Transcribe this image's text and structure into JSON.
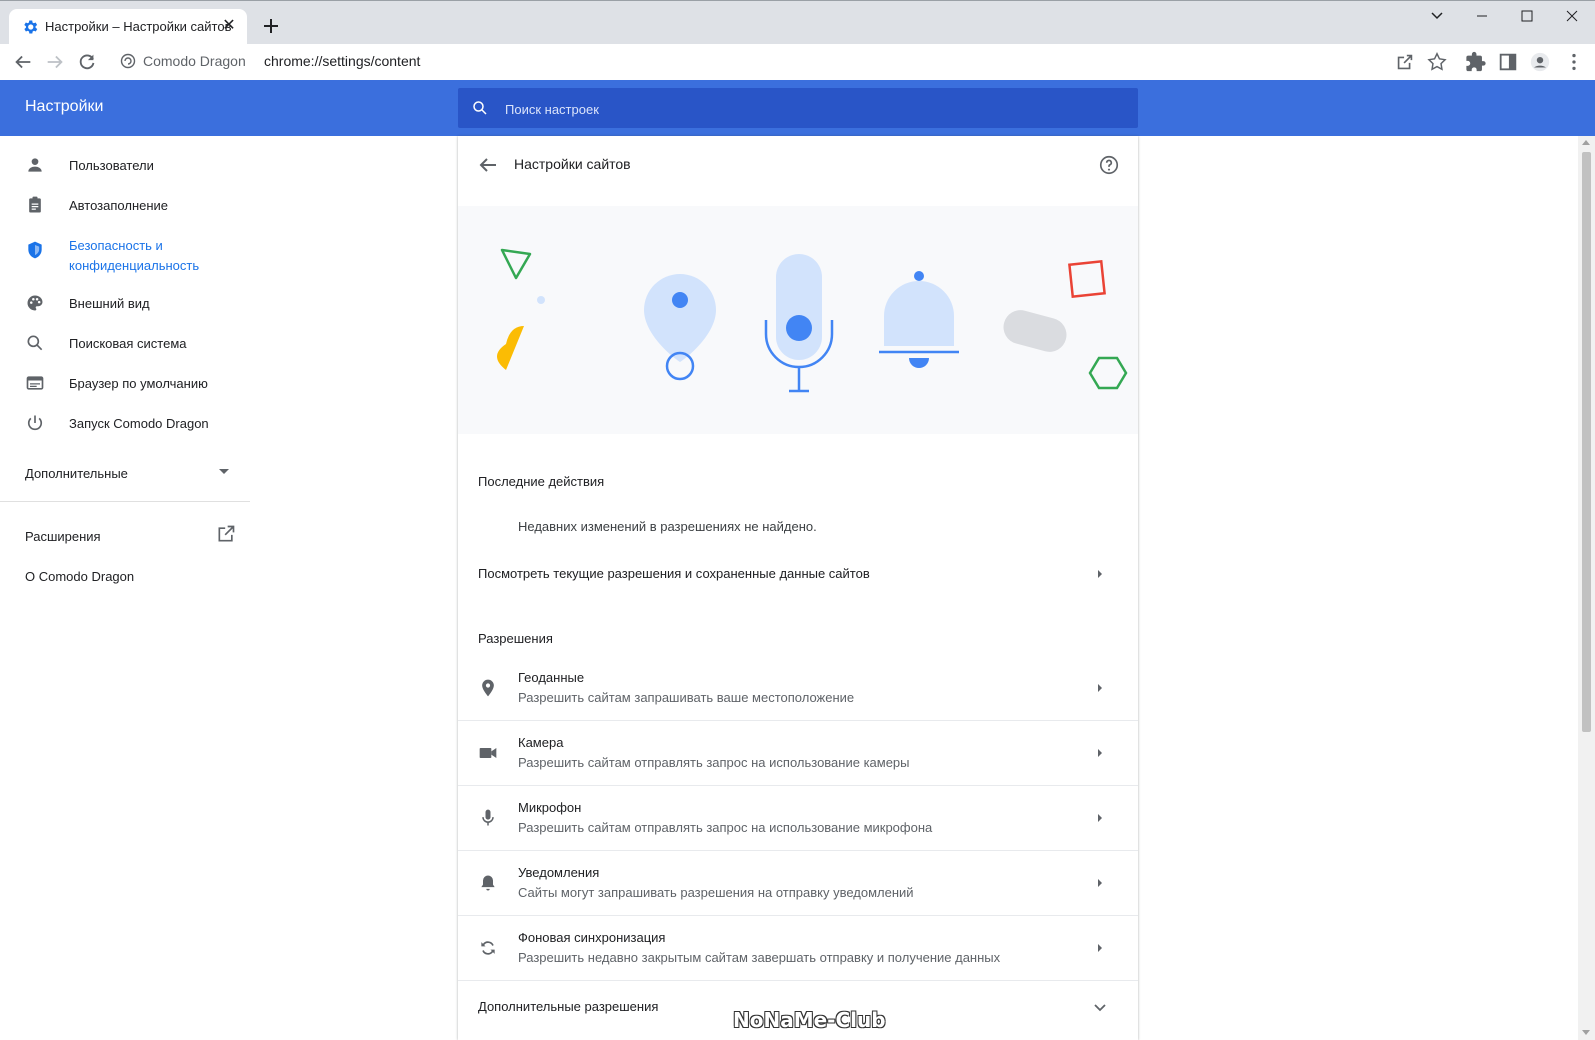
{
  "browser": {
    "tab_title": "Настройки – Настройки сайтов",
    "tab_favicon": "gear-icon",
    "brand": "Comodo Dragon",
    "url": "chrome://settings/content"
  },
  "header": {
    "title": "Настройки",
    "search_placeholder": "Поиск настроек",
    "color": "#3b6fdd"
  },
  "sidebar": {
    "items": [
      {
        "label": "Пользователи",
        "icon": "person-icon"
      },
      {
        "label": "Автозаполнение",
        "icon": "clipboard-icon"
      },
      {
        "label": "Безопасность и",
        "label2": "конфиденциальность",
        "icon": "shield-icon",
        "active": true
      },
      {
        "label": "Внешний вид",
        "icon": "palette-icon"
      },
      {
        "label": "Поисковая система",
        "icon": "search-icon"
      },
      {
        "label": "Браузер по умолчанию",
        "icon": "browser-window-icon"
      },
      {
        "label": "Запуск Comodo Dragon",
        "icon": "power-icon"
      }
    ],
    "advanced": "Дополнительные",
    "extensions": "Расширения",
    "about": "О Comodo Dragon"
  },
  "main": {
    "title": "Настройки сайтов",
    "recent_heading": "Последние действия",
    "recent_empty": "Недавних изменений в разрешениях не найдено.",
    "view_all": "Посмотреть текущие разрешения и сохраненные данные сайтов",
    "permissions_heading": "Разрешения",
    "permissions": [
      {
        "title": "Геоданные",
        "subtitle": "Разрешить сайтам запрашивать ваше местоположение",
        "icon": "location-pin-icon"
      },
      {
        "title": "Камера",
        "subtitle": "Разрешить сайтам отправлять запрос на использование камеры",
        "icon": "camera-icon"
      },
      {
        "title": "Микрофон",
        "subtitle": "Разрешить сайтам отправлять запрос на использование микрофона",
        "icon": "microphone-icon"
      },
      {
        "title": "Уведомления",
        "subtitle": "Сайты могут запрашивать разрешения на отправку уведомлений",
        "icon": "bell-icon"
      },
      {
        "title": "Фоновая синхронизация",
        "subtitle": "Разрешить недавно закрытым сайтам завершать отправку и получение данных",
        "icon": "sync-icon"
      }
    ],
    "more_permissions": "Дополнительные разрешения"
  },
  "watermark": "NoNaMe-Club"
}
